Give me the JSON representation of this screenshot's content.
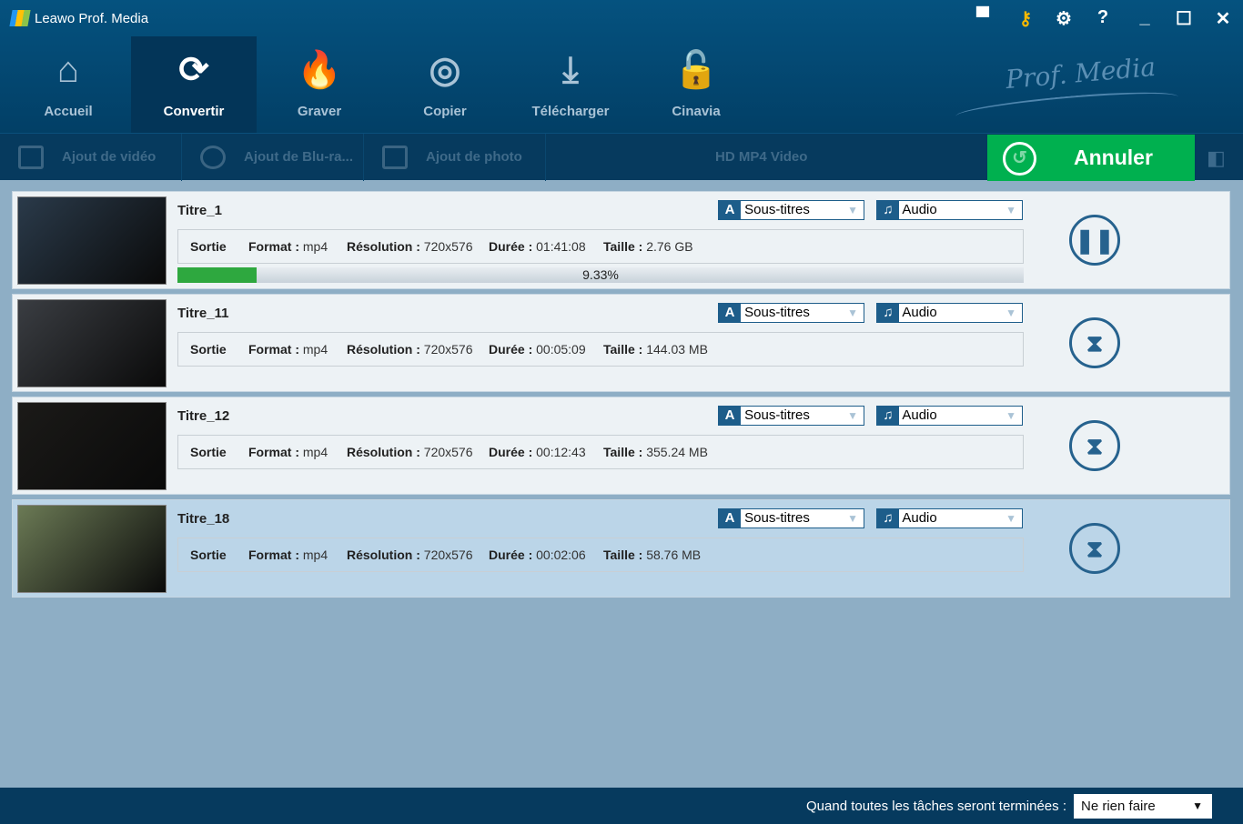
{
  "app": {
    "title": "Leawo Prof. Media",
    "brand": "Prof. Media"
  },
  "nav": [
    {
      "label": "Accueil",
      "icon": "⌂"
    },
    {
      "label": "Convertir",
      "icon": "⟳"
    },
    {
      "label": "Graver",
      "icon": "🔥"
    },
    {
      "label": "Copier",
      "icon": "◎"
    },
    {
      "label": "Télécharger",
      "icon": "⤓"
    },
    {
      "label": "Cinavia",
      "icon": "🔓"
    }
  ],
  "toolbar": {
    "add_video": "Ajout de vidéo",
    "add_bluray": "Ajout de Blu-ra...",
    "add_photo": "Ajout de photo",
    "profile": "HD MP4 Video",
    "cancel": "Annuler"
  },
  "labels": {
    "sortie": "Sortie",
    "format": "Format :",
    "resolution": "Résolution :",
    "duree": "Durée :",
    "taille": "Taille :",
    "subtitles": "Sous-titres",
    "audio": "Audio"
  },
  "rows": [
    {
      "title": "Titre_1",
      "format": "mp4",
      "resolution": "720x576",
      "duration": "01:41:08",
      "size": "2.76 GB",
      "progress": 9.33,
      "progress_label": "9.33%",
      "status": "pause",
      "thumb": "#2a3a4a"
    },
    {
      "title": "Titre_11",
      "format": "mp4",
      "resolution": "720x576",
      "duration": "00:05:09",
      "size": "144.03 MB",
      "status": "waiting",
      "thumb": "#3a3d42"
    },
    {
      "title": "Titre_12",
      "format": "mp4",
      "resolution": "720x576",
      "duration": "00:12:43",
      "size": "355.24 MB",
      "status": "waiting",
      "thumb": "#1b1a18"
    },
    {
      "title": "Titre_18",
      "format": "mp4",
      "resolution": "720x576",
      "duration": "00:02:06",
      "size": "58.76 MB",
      "status": "waiting",
      "thumb": "#6b7a55"
    }
  ],
  "footer": {
    "label": "Quand toutes les tâches seront terminées :",
    "select": "Ne rien faire"
  }
}
